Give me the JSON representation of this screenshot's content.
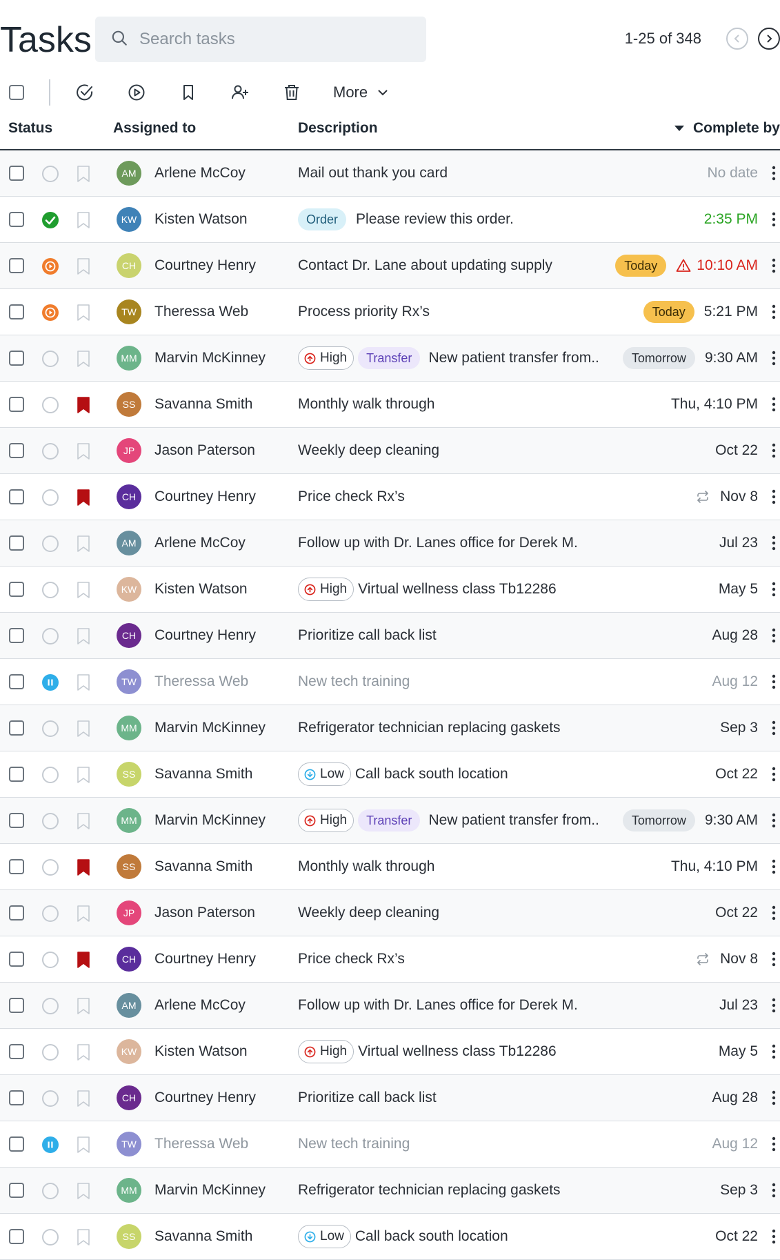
{
  "header": {
    "title": "Tasks",
    "search_placeholder": "Search tasks",
    "pagination": "1-25 of 348"
  },
  "toolbar": {
    "more_label": "More",
    "icons": [
      "complete-icon",
      "start-icon",
      "bookmark-icon",
      "assign-user-icon",
      "trash-icon"
    ]
  },
  "columns": {
    "status": "Status",
    "assigned": "Assigned to",
    "description": "Description",
    "complete_by": "Complete by"
  },
  "rows": [
    {
      "status": "none",
      "flag": false,
      "initials": "AM",
      "avatar": "#6d9a5b",
      "name": "Arlene McCoy",
      "description": "Mail out thank you card",
      "due": "No date",
      "due_style": "grey"
    },
    {
      "status": "done",
      "flag": false,
      "initials": "KW",
      "avatar": "#3f82b7",
      "name": "Kisten Watson",
      "tag": "Order",
      "description": "Please review this order.",
      "due": "2:35 PM",
      "due_style": "green"
    },
    {
      "status": "progress",
      "flag": false,
      "initials": "CH",
      "avatar": "#c9d36e",
      "name": "Courtney Henry",
      "description": "Contact Dr. Lane about updating supply",
      "pill": "Today",
      "pill_style": "today",
      "warning": true,
      "due": "10:10 AM",
      "due_style": "red"
    },
    {
      "status": "progress",
      "flag": false,
      "initials": "TW",
      "avatar": "#a8851f",
      "name": "Theressa Web",
      "description": "Process priority Rx’s",
      "pill": "Today",
      "pill_style": "today",
      "due": "5:21 PM"
    },
    {
      "status": "none",
      "flag": false,
      "initials": "MM",
      "avatar": "#6cb48a",
      "name": "Marvin McKinney",
      "priority": "High",
      "tag": "Transfer",
      "description": "New patient transfer from..",
      "pill": "Tomorrow",
      "pill_style": "tomorrow",
      "due": "9:30 AM"
    },
    {
      "status": "none",
      "flag": true,
      "initials": "SS",
      "avatar": "#c07a3a",
      "name": "Savanna Smith",
      "description": "Monthly walk through",
      "due": "Thu, 4:10 PM"
    },
    {
      "status": "none",
      "flag": false,
      "initials": "JP",
      "avatar": "#e4467a",
      "name": "Jason Paterson",
      "description": "Weekly deep cleaning",
      "due": "Oct 22"
    },
    {
      "status": "none",
      "flag": true,
      "initials": "CH",
      "avatar": "#5a2d9c",
      "name": "Courtney Henry",
      "description": "Price check Rx’s",
      "repeat": true,
      "due": "Nov 8"
    },
    {
      "status": "none",
      "flag": false,
      "initials": "AM",
      "avatar": "#678f9e",
      "name": "Arlene McCoy",
      "description": "Follow up with Dr. Lanes office for Derek M.",
      "due": "Jul 23"
    },
    {
      "status": "none",
      "flag": false,
      "initials": "KW",
      "avatar": "#dcb69c",
      "name": "Kisten Watson",
      "priority": "High",
      "description": "Virtual wellness class Tb12286",
      "due": "May 5"
    },
    {
      "status": "none",
      "flag": false,
      "initials": "CH",
      "avatar": "#6a2a8e",
      "name": "Courtney Henry",
      "description": "Prioritize call back list",
      "due": "Aug 28"
    },
    {
      "status": "paused",
      "flag": false,
      "initials": "TW",
      "avatar": "#8d8fd1",
      "name": "Theressa Web",
      "description": "New tech training",
      "due": "Aug 12",
      "due_style": "grey",
      "muted": true
    },
    {
      "status": "none",
      "flag": false,
      "initials": "MM",
      "avatar": "#6cb48a",
      "name": "Marvin McKinney",
      "description": "Refrigerator technician replacing gaskets",
      "due": "Sep 3"
    },
    {
      "status": "none",
      "flag": false,
      "initials": "SS",
      "avatar": "#c7d56a",
      "name": "Savanna Smith",
      "priority": "Low",
      "description": "Call back south location",
      "due": "Oct 22"
    },
    {
      "status": "none",
      "flag": false,
      "initials": "MM",
      "avatar": "#6cb48a",
      "name": "Marvin McKinney",
      "priority": "High",
      "tag": "Transfer",
      "description": "New patient transfer from..",
      "pill": "Tomorrow",
      "pill_style": "tomorrow",
      "due": "9:30 AM"
    },
    {
      "status": "none",
      "flag": true,
      "initials": "SS",
      "avatar": "#c07a3a",
      "name": "Savanna Smith",
      "description": "Monthly walk through",
      "due": "Thu, 4:10 PM"
    },
    {
      "status": "none",
      "flag": false,
      "initials": "JP",
      "avatar": "#e4467a",
      "name": "Jason Paterson",
      "description": "Weekly deep cleaning",
      "due": "Oct 22"
    },
    {
      "status": "none",
      "flag": true,
      "initials": "CH",
      "avatar": "#5a2d9c",
      "name": "Courtney Henry",
      "description": "Price check Rx’s",
      "repeat": true,
      "due": "Nov 8"
    },
    {
      "status": "none",
      "flag": false,
      "initials": "AM",
      "avatar": "#678f9e",
      "name": "Arlene McCoy",
      "description": "Follow up with Dr. Lanes office for Derek M.",
      "due": "Jul 23"
    },
    {
      "status": "none",
      "flag": false,
      "initials": "KW",
      "avatar": "#dcb69c",
      "name": "Kisten Watson",
      "priority": "High",
      "description": "Virtual wellness class Tb12286",
      "due": "May 5"
    },
    {
      "status": "none",
      "flag": false,
      "initials": "CH",
      "avatar": "#6a2a8e",
      "name": "Courtney Henry",
      "description": "Prioritize call back list",
      "due": "Aug 28"
    },
    {
      "status": "paused",
      "flag": false,
      "initials": "TW",
      "avatar": "#8d8fd1",
      "name": "Theressa Web",
      "description": "New tech training",
      "due": "Aug 12",
      "due_style": "grey",
      "muted": true
    },
    {
      "status": "none",
      "flag": false,
      "initials": "MM",
      "avatar": "#6cb48a",
      "name": "Marvin McKinney",
      "description": "Refrigerator technician replacing gaskets",
      "due": "Sep 3"
    },
    {
      "status": "none",
      "flag": false,
      "initials": "SS",
      "avatar": "#c7d56a",
      "name": "Savanna Smith",
      "priority": "Low",
      "description": "Call back south location",
      "due": "Oct 22"
    }
  ],
  "colors": {
    "flag": "#b50f12",
    "high": "#d9251d",
    "low": "#2eaee9"
  }
}
